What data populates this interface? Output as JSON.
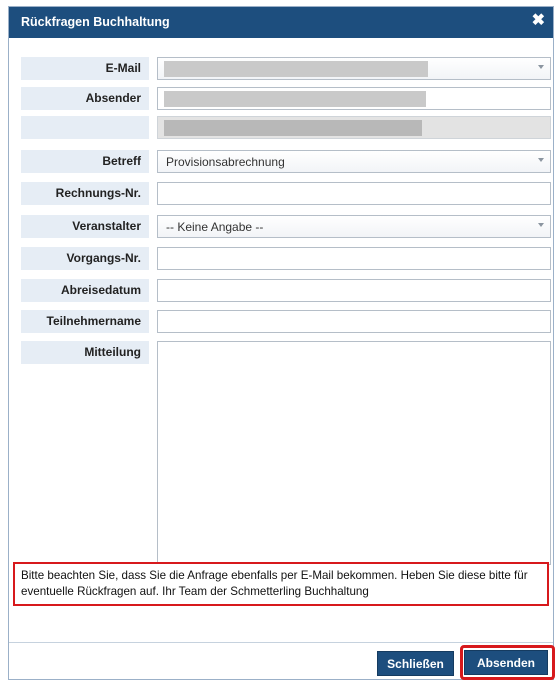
{
  "dialog": {
    "title": "Rückfragen Buchhaltung",
    "close_glyph": "✖"
  },
  "form": {
    "email_label": "E-Mail",
    "sender_label": "Absender",
    "subject_label": "Betreff",
    "subject_value": "Provisionsabrechnung",
    "invoice_label": "Rechnungs-Nr.",
    "organizer_label": "Veranstalter",
    "organizer_value": "-- Keine Angabe --",
    "booking_label": "Vorgangs-Nr.",
    "departure_label": "Abreisedatum",
    "participant_label": "Teilnehmername",
    "message_label": "Mitteilung"
  },
  "notice": {
    "text": "Bitte beachten Sie, dass Sie die Anfrage ebenfalls per E-Mail bekommen. Heben Sie diese bitte für eventuelle Rückfragen auf. Ihr Team der Schmetterling Buchhaltung"
  },
  "buttons": {
    "close_label": "Schließen",
    "send_label": "Absenden"
  },
  "colors": {
    "titlebar": "#1d4e7e",
    "label_bg": "#e6edf5",
    "highlight_red": "#d7191c"
  }
}
